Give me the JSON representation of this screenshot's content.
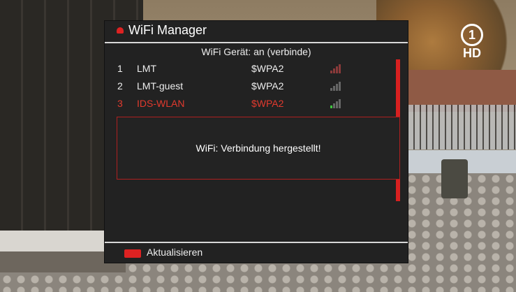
{
  "channel_logo": {
    "number": "1",
    "hd": "HD"
  },
  "dialog": {
    "title": "WiFi Manager",
    "status": "WiFi Gerät: an (verbinde)",
    "networks": [
      {
        "index": "1",
        "ssid": "LMT",
        "security": "$WPA2",
        "signal_icon": "signal-icon-weak-red"
      },
      {
        "index": "2",
        "ssid": "LMT-guest",
        "security": "$WPA2",
        "signal_icon": "signal-icon-gray"
      },
      {
        "index": "3",
        "ssid": "IDS-WLAN",
        "security": "$WPA2",
        "signal_icon": "signal-icon-green",
        "selected": true
      }
    ],
    "popup_message": "WiFi: Verbindung hergestellt!",
    "footer": {
      "red_button_label": "Aktualisieren"
    }
  },
  "colors": {
    "accent_red": "#d22222",
    "selected_text": "#e23a2e",
    "dialog_bg": "#222222"
  }
}
